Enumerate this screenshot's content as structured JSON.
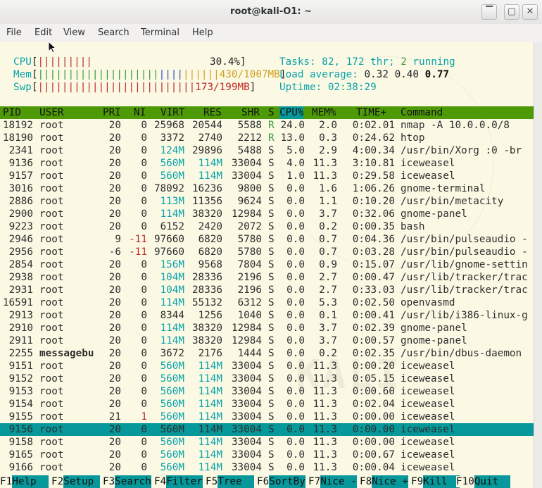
{
  "window": {
    "title": "root@kali-O1: ~",
    "buttons": [
      "▔",
      "▢",
      "✕"
    ]
  },
  "menu": [
    "File",
    "Edit",
    "View",
    "Search",
    "Terminal",
    "Help"
  ],
  "meters": {
    "cpu": {
      "label": "CPU",
      "bars": "|||||||||",
      "value": "30.4%"
    },
    "mem": {
      "label": "Mem",
      "bars_green": "||||||||||||||||||||",
      "bars_blue": "||||",
      "bars_yellow": "||||||",
      "value": "430/1007MB"
    },
    "swp": {
      "label": "Swp",
      "bars": "||||||||||||||||||||||||||",
      "value": "173/199MB"
    }
  },
  "stats": {
    "tasks_label": "Tasks:",
    "tasks": "82,",
    "threads": "172",
    "thr_label": "thr;",
    "running": "2",
    "running_label": "running",
    "load_label": "Load average:",
    "load1": "0.32",
    "load5": "0.40",
    "load15": "0.77",
    "uptime_label": "Uptime:",
    "uptime": "02:38:29"
  },
  "columns": [
    "PID",
    "USER",
    "PRI",
    "NI",
    "VIRT",
    "RES",
    "SHR",
    "S",
    "CPU%",
    "MEM%",
    "TIME+",
    "Command"
  ],
  "processes": [
    {
      "pid": "18192",
      "user": "root",
      "pri": "20",
      "ni": "0",
      "virt": "25968",
      "res": "20544",
      "shr": "5588",
      "s": "R",
      "cpu": "24.0",
      "mem": "2.0",
      "time": "0:02.01",
      "cmd": "nmap -A 10.0.0.0/8"
    },
    {
      "pid": "18190",
      "user": "root",
      "pri": "20",
      "ni": "0",
      "virt": "3372",
      "res": "2740",
      "shr": "2212",
      "s": "R",
      "cpu": "13.0",
      "mem": "0.3",
      "time": "0:24.62",
      "cmd": "htop"
    },
    {
      "pid": "2341",
      "user": "root",
      "pri": "20",
      "ni": "0",
      "virt": "124M",
      "res": "29896",
      "shr": "5488",
      "s": "S",
      "cpu": "5.0",
      "mem": "2.9",
      "time": "4:00.34",
      "cmd": "/usr/bin/Xorg :0 -br"
    },
    {
      "pid": "9136",
      "user": "root",
      "pri": "20",
      "ni": "0",
      "virt": "560M",
      "res": "114M",
      "shr": "33004",
      "s": "S",
      "cpu": "4.0",
      "mem": "11.3",
      "time": "3:10.81",
      "cmd": "iceweasel"
    },
    {
      "pid": "9157",
      "user": "root",
      "pri": "20",
      "ni": "0",
      "virt": "560M",
      "res": "114M",
      "shr": "33004",
      "s": "S",
      "cpu": "1.0",
      "mem": "11.3",
      "time": "0:29.58",
      "cmd": "iceweasel"
    },
    {
      "pid": "3016",
      "user": "root",
      "pri": "20",
      "ni": "0",
      "virt": "78092",
      "res": "16236",
      "shr": "9800",
      "s": "S",
      "cpu": "0.0",
      "mem": "1.6",
      "time": "1:06.26",
      "cmd": "gnome-terminal"
    },
    {
      "pid": "2886",
      "user": "root",
      "pri": "20",
      "ni": "0",
      "virt": "113M",
      "res": "11356",
      "shr": "9624",
      "s": "S",
      "cpu": "0.0",
      "mem": "1.1",
      "time": "0:10.20",
      "cmd": "/usr/bin/metacity"
    },
    {
      "pid": "2900",
      "user": "root",
      "pri": "20",
      "ni": "0",
      "virt": "114M",
      "res": "38320",
      "shr": "12984",
      "s": "S",
      "cpu": "0.0",
      "mem": "3.7",
      "time": "0:32.06",
      "cmd": "gnome-panel"
    },
    {
      "pid": "9223",
      "user": "root",
      "pri": "20",
      "ni": "0",
      "virt": "6152",
      "res": "2420",
      "shr": "2072",
      "s": "S",
      "cpu": "0.0",
      "mem": "0.2",
      "time": "0:00.35",
      "cmd": "bash"
    },
    {
      "pid": "2946",
      "user": "root",
      "pri": "9",
      "ni": "-11",
      "virt": "97660",
      "res": "6820",
      "shr": "5780",
      "s": "S",
      "cpu": "0.0",
      "mem": "0.7",
      "time": "0:04.36",
      "cmd": "/usr/bin/pulseaudio -"
    },
    {
      "pid": "2956",
      "user": "root",
      "pri": "-6",
      "ni": "-11",
      "virt": "97660",
      "res": "6820",
      "shr": "5780",
      "s": "S",
      "cpu": "0.0",
      "mem": "0.7",
      "time": "0:03.28",
      "cmd": "/usr/bin/pulseaudio -"
    },
    {
      "pid": "2854",
      "user": "root",
      "pri": "20",
      "ni": "0",
      "virt": "156M",
      "res": "9568",
      "shr": "7804",
      "s": "S",
      "cpu": "0.0",
      "mem": "0.9",
      "time": "0:15.07",
      "cmd": "/usr/lib/gnome-settin"
    },
    {
      "pid": "2938",
      "user": "root",
      "pri": "20",
      "ni": "0",
      "virt": "104M",
      "res": "28336",
      "shr": "2196",
      "s": "S",
      "cpu": "0.0",
      "mem": "2.7",
      "time": "0:00.47",
      "cmd": "/usr/lib/tracker/trac"
    },
    {
      "pid": "2931",
      "user": "root",
      "pri": "20",
      "ni": "0",
      "virt": "104M",
      "res": "28336",
      "shr": "2196",
      "s": "S",
      "cpu": "0.0",
      "mem": "2.7",
      "time": "0:33.03",
      "cmd": "/usr/lib/tracker/trac"
    },
    {
      "pid": "16591",
      "user": "root",
      "pri": "20",
      "ni": "0",
      "virt": "114M",
      "res": "55132",
      "shr": "6312",
      "s": "S",
      "cpu": "0.0",
      "mem": "5.3",
      "time": "0:02.50",
      "cmd": "openvasmd"
    },
    {
      "pid": "2913",
      "user": "root",
      "pri": "20",
      "ni": "0",
      "virt": "8344",
      "res": "1256",
      "shr": "1040",
      "s": "S",
      "cpu": "0.0",
      "mem": "0.1",
      "time": "0:00.41",
      "cmd": "/usr/lib/i386-linux-g"
    },
    {
      "pid": "2910",
      "user": "root",
      "pri": "20",
      "ni": "0",
      "virt": "114M",
      "res": "38320",
      "shr": "12984",
      "s": "S",
      "cpu": "0.0",
      "mem": "3.7",
      "time": "0:02.39",
      "cmd": "gnome-panel"
    },
    {
      "pid": "2911",
      "user": "root",
      "pri": "20",
      "ni": "0",
      "virt": "114M",
      "res": "38320",
      "shr": "12984",
      "s": "S",
      "cpu": "0.0",
      "mem": "3.7",
      "time": "0:00.57",
      "cmd": "gnome-panel"
    },
    {
      "pid": "2255",
      "user": "messagebu",
      "pri": "20",
      "ni": "0",
      "virt": "3672",
      "res": "2176",
      "shr": "1444",
      "s": "S",
      "cpu": "0.0",
      "mem": "0.2",
      "time": "0:02.35",
      "cmd": "/usr/bin/dbus-daemon"
    },
    {
      "pid": "9151",
      "user": "root",
      "pri": "20",
      "ni": "0",
      "virt": "560M",
      "res": "114M",
      "shr": "33004",
      "s": "S",
      "cpu": "0.0",
      "mem": "11.3",
      "time": "0:00.20",
      "cmd": "iceweasel"
    },
    {
      "pid": "9152",
      "user": "root",
      "pri": "20",
      "ni": "0",
      "virt": "560M",
      "res": "114M",
      "shr": "33004",
      "s": "S",
      "cpu": "0.0",
      "mem": "11.3",
      "time": "0:05.15",
      "cmd": "iceweasel"
    },
    {
      "pid": "9153",
      "user": "root",
      "pri": "20",
      "ni": "0",
      "virt": "560M",
      "res": "114M",
      "shr": "33004",
      "s": "S",
      "cpu": "0.0",
      "mem": "11.3",
      "time": "0:00.60",
      "cmd": "iceweasel"
    },
    {
      "pid": "9154",
      "user": "root",
      "pri": "20",
      "ni": "0",
      "virt": "560M",
      "res": "114M",
      "shr": "33004",
      "s": "S",
      "cpu": "0.0",
      "mem": "11.3",
      "time": "0:02.04",
      "cmd": "iceweasel"
    },
    {
      "pid": "9155",
      "user": "root",
      "pri": "21",
      "ni": "1",
      "virt": "560M",
      "res": "114M",
      "shr": "33004",
      "s": "S",
      "cpu": "0.0",
      "mem": "11.3",
      "time": "0:00.00",
      "cmd": "iceweasel"
    },
    {
      "pid": "9156",
      "user": "root",
      "pri": "20",
      "ni": "0",
      "virt": "560M",
      "res": "114M",
      "shr": "33004",
      "s": "S",
      "cpu": "0.0",
      "mem": "11.3",
      "time": "0:00.00",
      "cmd": "iceweasel",
      "selected": true
    },
    {
      "pid": "9158",
      "user": "root",
      "pri": "20",
      "ni": "0",
      "virt": "560M",
      "res": "114M",
      "shr": "33004",
      "s": "S",
      "cpu": "0.0",
      "mem": "11.3",
      "time": "0:00.00",
      "cmd": "iceweasel"
    },
    {
      "pid": "9165",
      "user": "root",
      "pri": "20",
      "ni": "0",
      "virt": "560M",
      "res": "114M",
      "shr": "33004",
      "s": "S",
      "cpu": "0.0",
      "mem": "11.3",
      "time": "0:00.67",
      "cmd": "iceweasel"
    },
    {
      "pid": "9166",
      "user": "root",
      "pri": "20",
      "ni": "0",
      "virt": "560M",
      "res": "114M",
      "shr": "33004",
      "s": "S",
      "cpu": "0.0",
      "mem": "11.3",
      "time": "0:00.04",
      "cmd": "iceweasel"
    }
  ],
  "fkeys": [
    {
      "key": "F1",
      "label": "Help  "
    },
    {
      "key": "F2",
      "label": "Setup "
    },
    {
      "key": "F3",
      "label": "Search"
    },
    {
      "key": "F4",
      "label": "Filter"
    },
    {
      "key": "F5",
      "label": "Tree  "
    },
    {
      "key": "F6",
      "label": "SortBy"
    },
    {
      "key": "F7",
      "label": "Nice -"
    },
    {
      "key": "F8",
      "label": "Nice +"
    },
    {
      "key": "F9",
      "label": "Kill  "
    },
    {
      "key": "F10",
      "label": "Quit  "
    }
  ]
}
